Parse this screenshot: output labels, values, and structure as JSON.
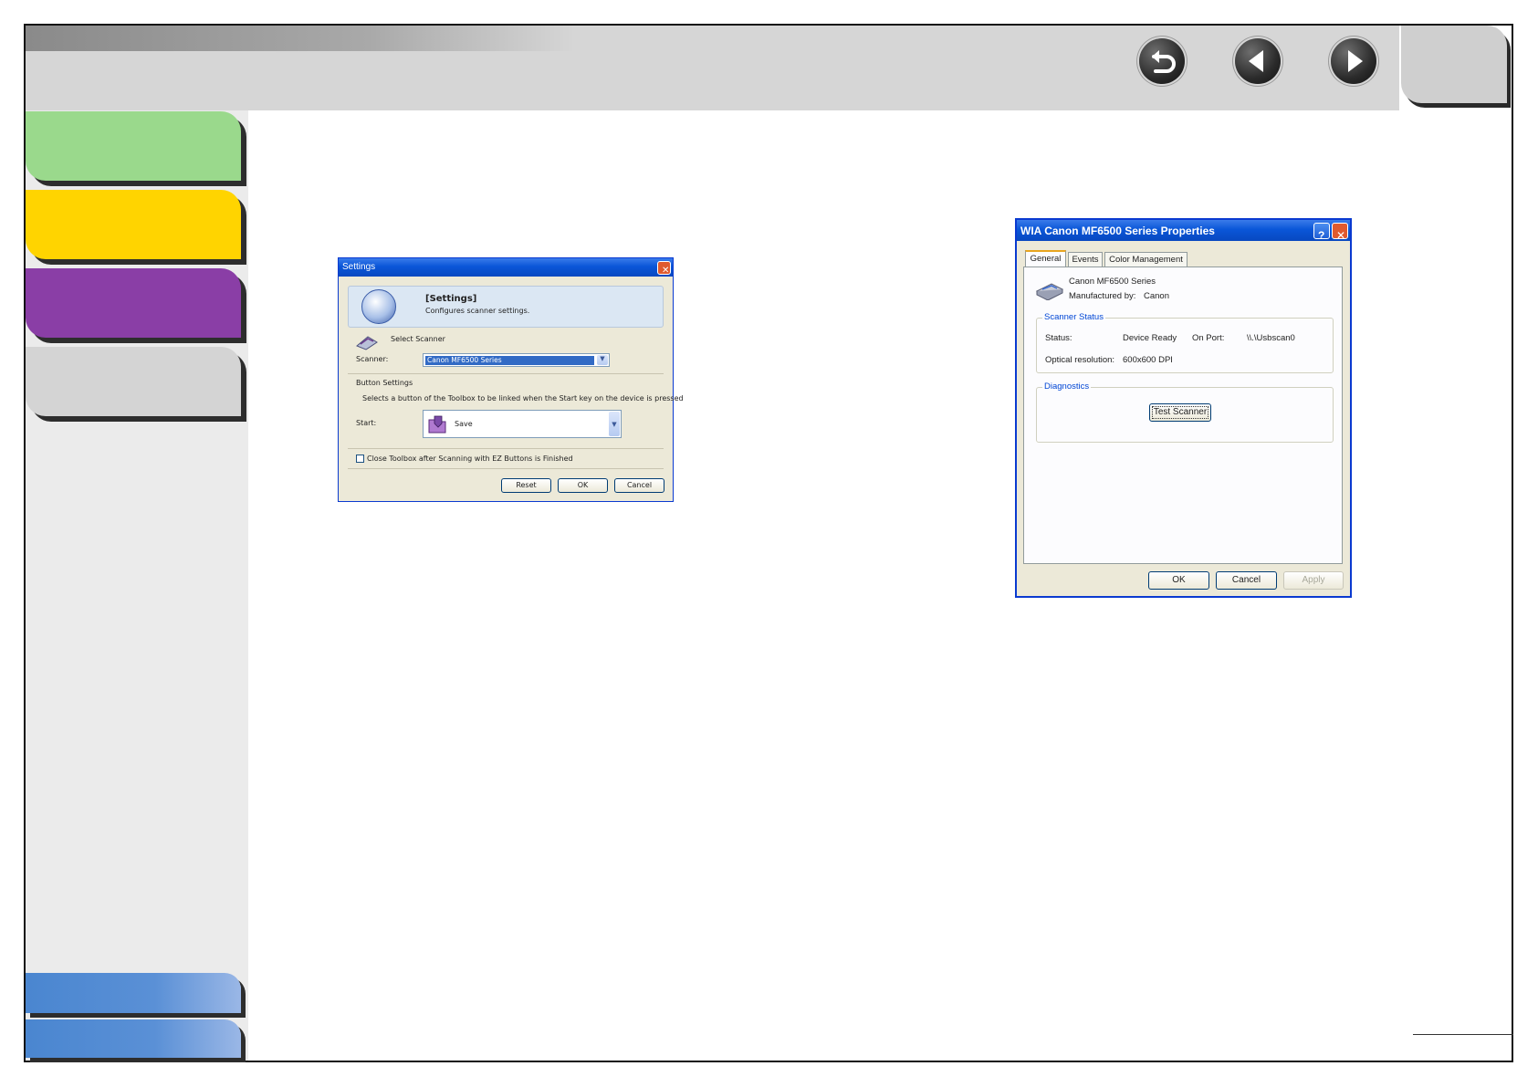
{
  "settings_dialog": {
    "title": "Settings",
    "close_glyph": "✕",
    "banner_heading": "[Settings]",
    "banner_sub": "Configures scanner settings.",
    "select_scanner_label": "Select Scanner",
    "scanner_label": "Scanner:",
    "scanner_value": "Canon MF6500 Series",
    "button_settings_label": "Button Settings",
    "button_settings_desc": "Selects a button of the Toolbox to be linked when the Start key on the device is pressed",
    "start_label": "Start:",
    "start_value": "Save",
    "close_toolbox_label": "Close Toolbox after Scanning with EZ Buttons is Finished",
    "close_toolbox_checked": false,
    "reset_button": "Reset",
    "ok_button": "OK",
    "cancel_button": "Cancel"
  },
  "wia_dialog": {
    "title": "WIA Canon MF6500 Series Properties",
    "help_glyph": "?",
    "close_glyph": "✕",
    "tabs": [
      {
        "label": "General",
        "active": true
      },
      {
        "label": "Events",
        "active": false
      },
      {
        "label": "Color Management",
        "active": false
      }
    ],
    "device_name": "Canon MF6500 Series",
    "manufacturer_label": "Manufactured by:",
    "manufacturer_value": "Canon",
    "scanner_status_caption": "Scanner Status",
    "status_label": "Status:",
    "status_value": "Device Ready",
    "port_label": "On Port:",
    "port_value": "\\\\.\\Usbscan0",
    "resolution_label": "Optical resolution:",
    "resolution_value": "600x600 DPI",
    "diagnostics_caption": "Diagnostics",
    "test_scanner_button": "Test Scanner",
    "ok_button": "OK",
    "cancel_button": "Cancel",
    "apply_button": "Apply"
  },
  "colors": {
    "tab_green": "#9ad98c",
    "tab_yellow": "#ffd400",
    "tab_purple": "#8a3ea6",
    "tab_gray": "#d4d4d4",
    "sidebar_blue": "#4a86d0",
    "xp_title_blue": "#0a56d8"
  },
  "icons": {
    "back": "return-arrow-icon",
    "previous": "left-triangle-icon",
    "next": "right-triangle-icon"
  }
}
